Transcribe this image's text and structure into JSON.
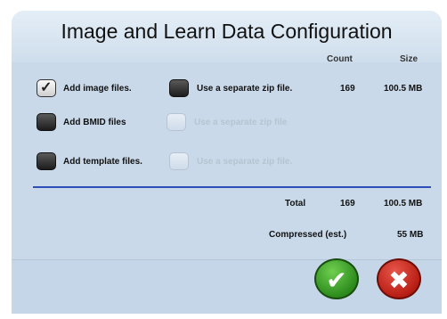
{
  "dialog": {
    "title": "Image and Learn Data Configuration",
    "columns": {
      "count": "Count",
      "size": "Size"
    }
  },
  "rows": [
    {
      "label": "Add image files.",
      "checked": true,
      "zip_label": "Use a separate zip file.",
      "zip_enabled": true,
      "count": "169",
      "size": "100.5 MB"
    },
    {
      "label": "Add BMID files",
      "checked": false,
      "zip_label": "Use a separate zip file",
      "zip_enabled": false
    },
    {
      "label": "Add template files.",
      "checked": false,
      "zip_label": "Use a separate zip file.",
      "zip_enabled": false
    }
  ],
  "totals": {
    "total_label": "Total",
    "total_count": "169",
    "total_size": "100.5 MB",
    "compressed_label": "Compressed (est.)",
    "compressed_size": "55 MB"
  },
  "buttons": {
    "ok_icon": "checkmark-icon",
    "cancel_icon": "x-icon",
    "ok_color": "#2d8b1d",
    "cancel_color": "#b81e14"
  },
  "colors": {
    "dialog_bg": "#c9d9e9",
    "divider": "#2f4fb8"
  }
}
